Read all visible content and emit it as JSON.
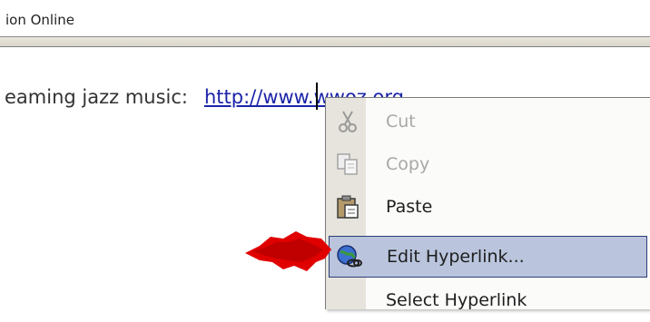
{
  "window": {
    "title": "ion Online"
  },
  "document": {
    "line_text": "eaming jazz music:",
    "link_text": "http://www.wwoz.org"
  },
  "context_menu": {
    "items": [
      {
        "label": "Cut",
        "icon": "scissors-icon",
        "enabled": false,
        "highlighted": false
      },
      {
        "label": "Copy",
        "icon": "copy-icon",
        "enabled": false,
        "highlighted": false
      },
      {
        "label": "Paste",
        "icon": "paste-icon",
        "enabled": true,
        "highlighted": false
      },
      {
        "label": "Edit Hyperlink...",
        "icon": "globe-link-icon",
        "enabled": true,
        "highlighted": true
      },
      {
        "label": "Select Hyperlink",
        "icon": "",
        "enabled": true,
        "highlighted": false
      }
    ]
  },
  "colors": {
    "link": "#1a24a8",
    "menu_highlight": "#bac5dd",
    "menu_highlight_border": "#2d3d7a",
    "arrow": "#e00000"
  }
}
